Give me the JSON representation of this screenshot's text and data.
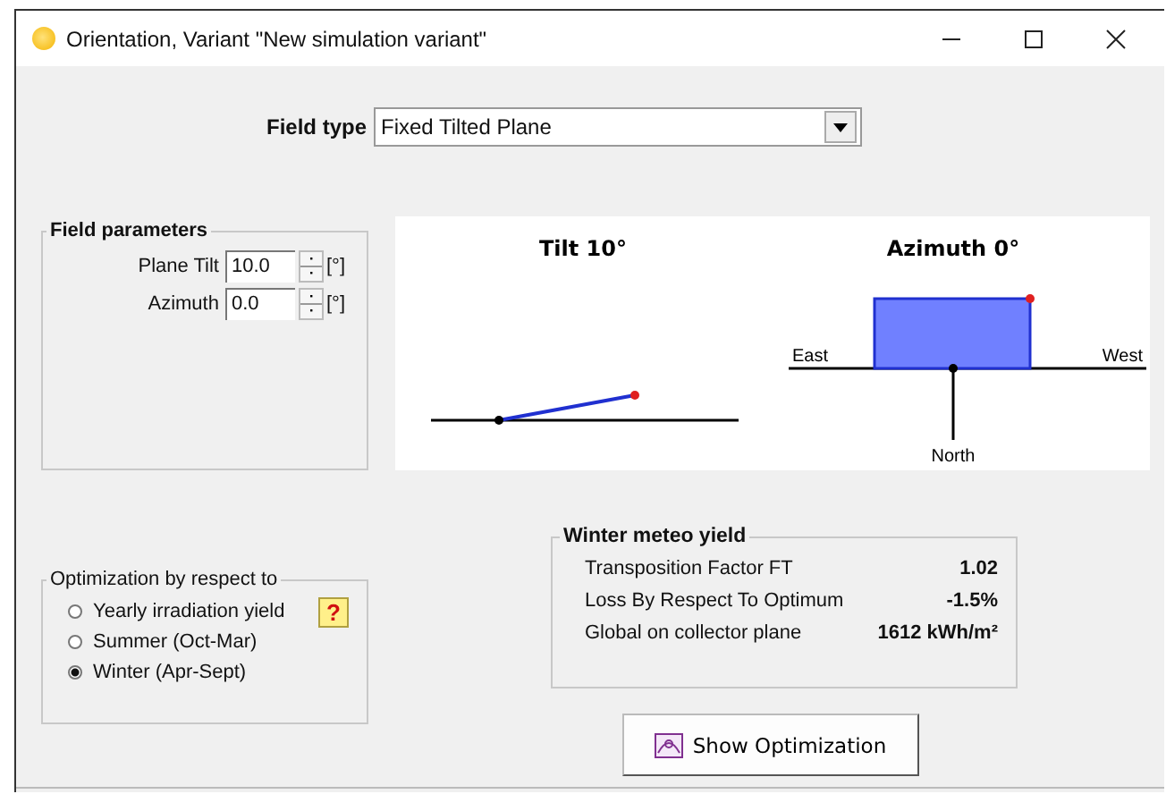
{
  "window": {
    "title": "Orientation, Variant \"New simulation variant\""
  },
  "field_type": {
    "label": "Field type",
    "value": "Fixed Tilted Plane"
  },
  "field_parameters": {
    "title": "Field parameters",
    "fields": [
      {
        "label": "Plane Tilt",
        "value": "10.0",
        "unit": "[°]"
      },
      {
        "label": "Azimuth",
        "value": "0.0",
        "unit": "[°]"
      }
    ]
  },
  "diagram": {
    "tilt_title": "Tilt 10°",
    "azimuth_title": "Azimuth 0°",
    "east": "East",
    "west": "West",
    "north": "North"
  },
  "optimization": {
    "title": "Optimization by respect to",
    "help": "?",
    "options": [
      {
        "label": "Yearly irradiation yield",
        "selected": false
      },
      {
        "label": "Summer (Oct-Mar)",
        "selected": false
      },
      {
        "label": "Winter (Apr-Sept)",
        "selected": true
      }
    ]
  },
  "meteo_yield": {
    "title": "Winter meteo yield",
    "rows": [
      {
        "label": "Transposition Factor FT",
        "value": "1.02"
      },
      {
        "label": "Loss By Respect To Optimum",
        "value": "-1.5%"
      },
      {
        "label": "Global on collector plane",
        "value": "1612 kWh/m²"
      }
    ]
  },
  "buttons": [
    {
      "label": "Show Optimization"
    }
  ]
}
